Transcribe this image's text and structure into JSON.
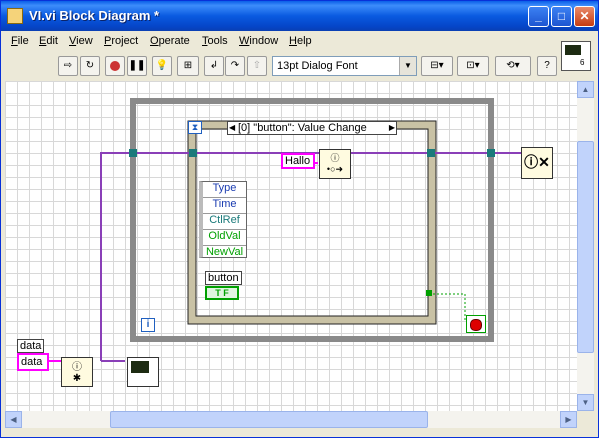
{
  "window": {
    "title": "VI.vi Block Diagram *",
    "buttons": {
      "minimize": "_",
      "maximize": "□",
      "close": "✕"
    }
  },
  "menu": [
    "File",
    "Edit",
    "View",
    "Project",
    "Operate",
    "Tools",
    "Window",
    "Help"
  ],
  "menu_mnemonics": [
    "F",
    "E",
    "V",
    "P",
    "O",
    "T",
    "W",
    "H"
  ],
  "toolbar": {
    "font": "13pt Dialog Font"
  },
  "diagram": {
    "event_case": "[0] \"button\": Value Change",
    "event_fields": [
      "Type",
      "Time",
      "CtlRef",
      "OldVal",
      "NewVal"
    ],
    "string_const": "Hallo",
    "data_label": "data",
    "data_const": "data",
    "button_label": "button",
    "bool_text": "T F",
    "iteration": "i",
    "wire_color": "#8a3fb8",
    "string_color": "#ff00ff",
    "bool_color": "#00a000"
  }
}
